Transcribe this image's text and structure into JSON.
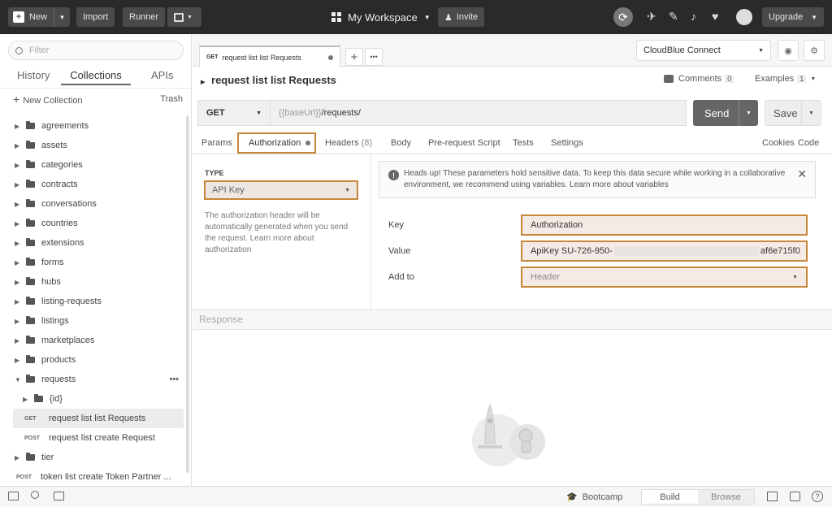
{
  "topbar": {
    "new_label": "New",
    "import_label": "Import",
    "runner_label": "Runner",
    "workspace_label": "My Workspace",
    "invite_label": "Invite",
    "upgrade_label": "Upgrade"
  },
  "sidebar": {
    "search_placeholder": "Filter",
    "tabs": [
      "History",
      "Collections",
      "APIs"
    ],
    "new_collection": "New Collection",
    "trash": "Trash",
    "folders": [
      "agreements",
      "assets",
      "categories",
      "contracts",
      "conversations",
      "countries",
      "extensions",
      "forms",
      "hubs",
      "listing-requests",
      "listings",
      "marketplaces",
      "products"
    ],
    "requests_folder": "requests",
    "id_folder": "{id}",
    "req1_method": "GET",
    "req1_name": "request list list Requests",
    "req2_method": "POST",
    "req2_name": "request list create Request",
    "tier_folder": "tier",
    "req3_method": "POST",
    "req3_name": "token list create Token Partner ..."
  },
  "tab": {
    "method": "GET",
    "name": "request list list Requests"
  },
  "environment": "CloudBlue Connect",
  "request": {
    "title": "request list list Requests",
    "comments_label": "Comments",
    "comments_count": "0",
    "examples_label": "Examples",
    "examples_count": "1",
    "method": "GET",
    "url_var": "{{baseUrl}}",
    "url_path": "/requests/",
    "send_label": "Send",
    "save_label": "Save"
  },
  "subtabs": {
    "params": "Params",
    "authorization": "Authorization",
    "headers": "Headers",
    "headers_count": "(8)",
    "body": "Body",
    "prerequest": "Pre-request Script",
    "tests": "Tests",
    "settings": "Settings",
    "cookies": "Cookies",
    "code": "Code"
  },
  "auth": {
    "type_label": "TYPE",
    "type_value": "API Key",
    "description": "The authorization header will be automatically generated when you send the request. Learn more about authorization",
    "notice": "Heads up! These parameters hold sensitive data. To keep this data secure while working in a collaborative environment, we recommend using variables. Learn more about variables",
    "key_label": "Key",
    "key_value": "Authorization",
    "value_label": "Value",
    "value_prefix": "ApiKey SU-726-950-",
    "value_suffix": "af6e715f0",
    "addto_label": "Add to",
    "addto_value": "Header"
  },
  "response_label": "Response",
  "bottombar": {
    "bootcamp": "Bootcamp",
    "build": "Build",
    "browse": "Browse"
  }
}
